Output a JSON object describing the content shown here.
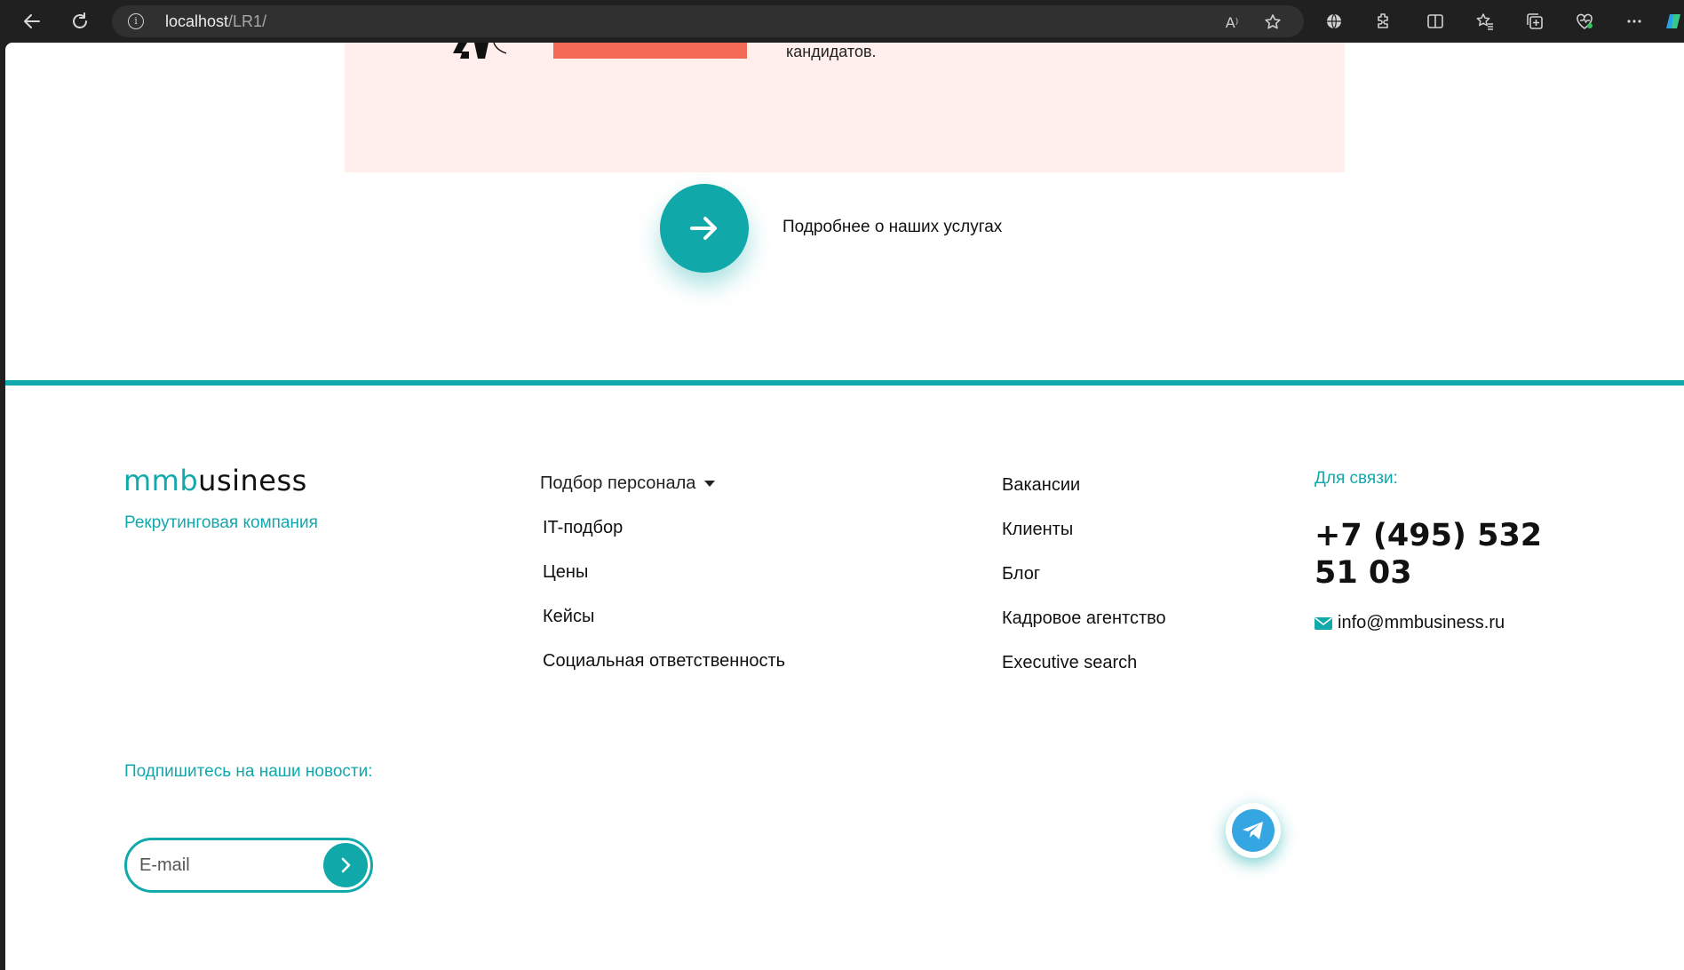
{
  "browser": {
    "url_host": "localhost",
    "url_path": "/LR1/"
  },
  "page": {
    "candidates_fragment": "кандидатов.",
    "more_services_label": "Подробнее о наших услугах"
  },
  "footer": {
    "logo_part1": "mmb",
    "logo_part2": "usiness",
    "tagline": "Рекрутинговая компания",
    "menu_dropdown": "Подбор персонала",
    "menu_col1": [
      "IT-подбор",
      "Цены",
      "Кейсы",
      "Социальная ответственность"
    ],
    "menu_col2": [
      "Вакансии",
      "Клиенты",
      "Блог",
      "Кадровое агентство",
      "Executive search"
    ],
    "contact_label": "Для связи:",
    "phone": "+7 (495) 532 51 03",
    "email": "info@mmbusiness.ru",
    "subscribe_label": "Подпишитесь на наши новости:",
    "email_placeholder": "E-mail"
  },
  "colors": {
    "accent": "#12a9ad",
    "coral": "#f26a55",
    "pink_bg": "#ffeeeb",
    "telegram": "#35a6e1"
  }
}
